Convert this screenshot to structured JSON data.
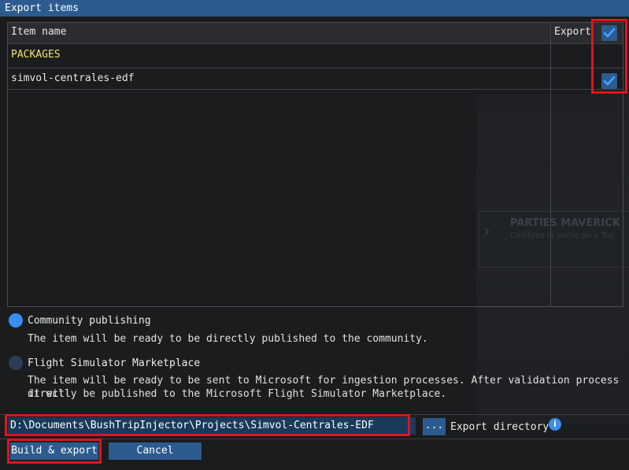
{
  "window": {
    "title": "Export items"
  },
  "table": {
    "headers": {
      "item_name": "Item name",
      "export": "Export"
    },
    "rows": [
      {
        "name": "PACKAGES",
        "checked": false
      },
      {
        "name": "simvol-centrales-edf",
        "checked": true
      }
    ],
    "select_all_checked": true
  },
  "background": {
    "banner": "PARTIES MAVERICK",
    "banner_sub": "Célébrez la sortie de « Top"
  },
  "publishing": {
    "community": {
      "label": "Community publishing",
      "description": "The item will be ready to be directly published to the community.",
      "selected": true
    },
    "marketplace": {
      "label": "Flight Simulator Marketplace",
      "description_line1": "The item will be ready to be sent to Microsoft for ingestion processes. After validation process it will",
      "description_line2": "directly be published to the Microsoft Flight Simulator Marketplace.",
      "selected": false
    }
  },
  "export_directory": {
    "path": "D:\\Documents\\BushTripInjector\\Projects\\Simvol-Centrales-EDF",
    "browse_label": "...",
    "label": "Export directory",
    "info_icon": "i"
  },
  "buttons": {
    "build": "Build & export",
    "cancel": "Cancel"
  },
  "colors": {
    "accent": "#2c5b8f",
    "highlight": "#e0141c",
    "package_text": "#f3e46b",
    "radio_on": "#3a8df0"
  }
}
